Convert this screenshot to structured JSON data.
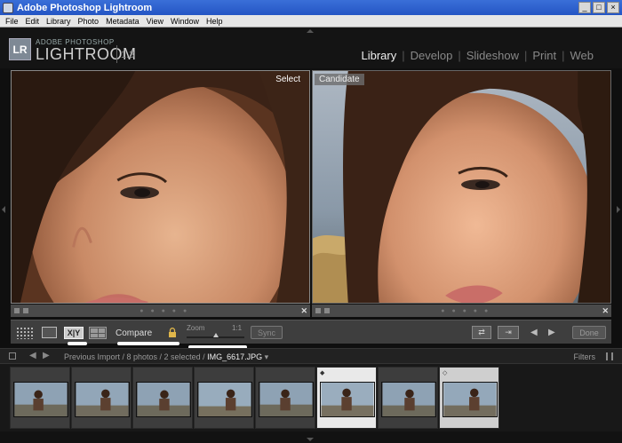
{
  "window": {
    "title": "Adobe Photoshop Lightroom"
  },
  "menu": [
    "File",
    "Edit",
    "Library",
    "Photo",
    "Metadata",
    "View",
    "Window",
    "Help"
  ],
  "brand": {
    "logo": "LR",
    "top": "ADOBE PHOTOSHOP",
    "main": "LIGHTROOM",
    "version": "1.3"
  },
  "modules": [
    {
      "label": "Library",
      "active": true
    },
    {
      "label": "Develop",
      "active": false
    },
    {
      "label": "Slideshow",
      "active": false
    },
    {
      "label": "Print",
      "active": false
    },
    {
      "label": "Web",
      "active": false
    }
  ],
  "panes": {
    "select_label": "Select",
    "candidate_label": "Candidate"
  },
  "toolbar": {
    "xy_label": "X|Y",
    "compare_label": "Compare",
    "zoom_label": "Zoom",
    "zoom_value": "1:1",
    "sync_label": "Sync",
    "done_label": "Done"
  },
  "filmstrip_header": {
    "path": "Previous Import / 8 photos / 2 selected / ",
    "file": "IMG_6617.JPG",
    "filters": "Filters"
  },
  "colors": {
    "accent_white": "#ffffff",
    "panel": "#3e3e3e",
    "background": "#0f0f0f"
  }
}
